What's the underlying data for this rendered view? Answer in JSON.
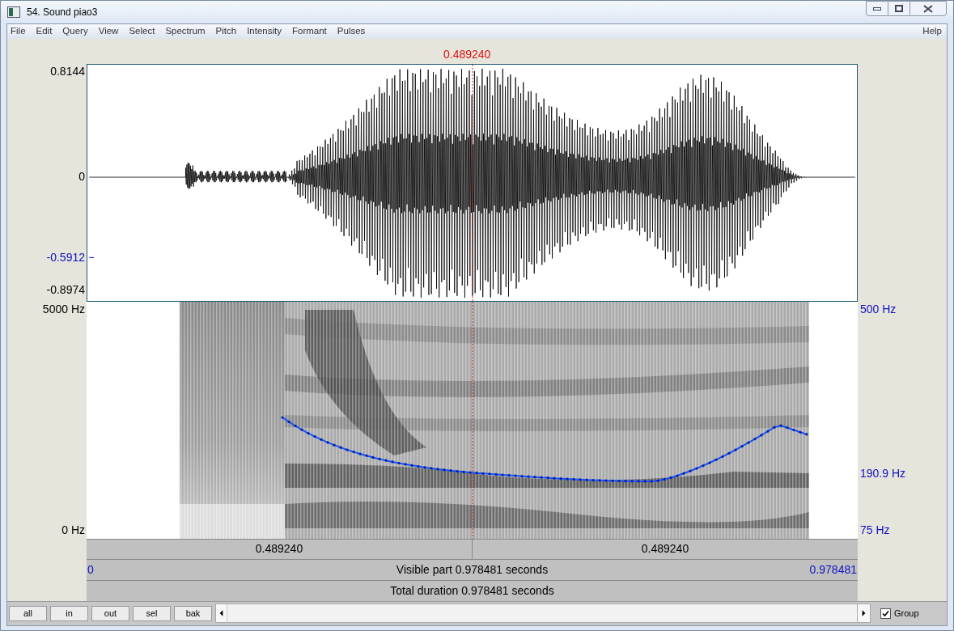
{
  "window": {
    "title": "54. Sound piao3"
  },
  "menu": {
    "items": [
      "File",
      "Edit",
      "Query",
      "View",
      "Select",
      "Spectrum",
      "Pitch",
      "Intensity",
      "Formant",
      "Pulses"
    ],
    "help": "Help"
  },
  "cursor": {
    "time": "0.489240"
  },
  "waveform": {
    "y_max": "0.8144",
    "y_zero": "0",
    "y_cursor": "-0.5912",
    "y_min": "-0.8974"
  },
  "spectrogram": {
    "freq_max": "5000 Hz",
    "freq_min": "0 Hz",
    "pitch_max": "500 Hz",
    "pitch_cursor": "190.9 Hz",
    "pitch_min": "75 Hz"
  },
  "time_bar": {
    "left_segment": "0.489240",
    "right_segment": "0.489240",
    "start": "0",
    "visible": "Visible part 0.978481 seconds",
    "end": "0.978481",
    "total": "Total duration 0.978481 seconds"
  },
  "buttons": [
    "all",
    "in",
    "out",
    "sel",
    "bak"
  ],
  "group": {
    "label": "Group",
    "checked": true
  }
}
